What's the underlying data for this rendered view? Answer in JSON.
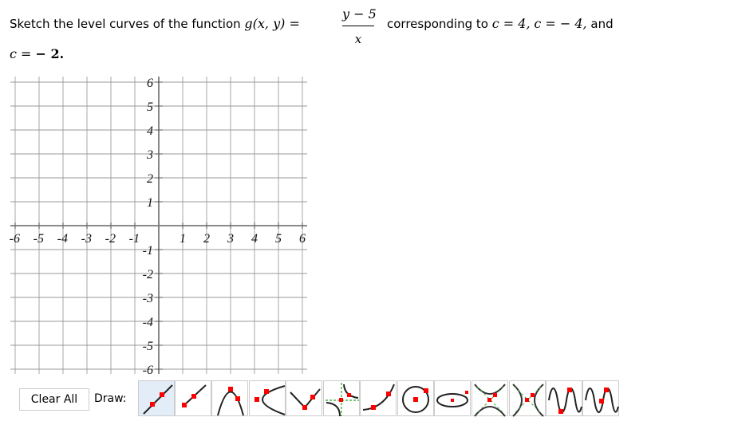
{
  "problem": {
    "text_before": "Sketch the level curves of the function ",
    "function_lhs": "g(x, y) = ",
    "fraction_numerator": "y − 5",
    "fraction_denominator": "x",
    "text_after": "corresponding to ",
    "c1": "c = 4,",
    "c2": "c =  − 4,",
    "text_and": " and",
    "c3_label": "c = ",
    "c3_value": " − 2."
  },
  "graph": {
    "x_range": [
      -6,
      6
    ],
    "y_range": [
      -6,
      6
    ],
    "x_tick_labels": [
      "-6",
      "-5",
      "-4",
      "-3",
      "-2",
      "-1",
      "1",
      "2",
      "3",
      "4",
      "5",
      "6"
    ],
    "y_tick_labels_positive": [
      "1",
      "2",
      "3",
      "4",
      "5",
      "6"
    ],
    "y_tick_labels_negative": [
      "-1",
      "-2",
      "-3",
      "-4",
      "-5",
      "-6"
    ],
    "grid": true
  },
  "toolbar": {
    "clear_label": "Clear All",
    "draw_label": "Draw:",
    "tools": [
      {
        "name": "line-tool",
        "active": true
      },
      {
        "name": "ray-tool",
        "active": false
      },
      {
        "name": "parabola-vertical-tool",
        "active": false
      },
      {
        "name": "parabola-horizontal-tool",
        "active": false
      },
      {
        "name": "absolute-value-tool",
        "active": false
      },
      {
        "name": "rational-tool",
        "active": false
      },
      {
        "name": "exponential-tool",
        "active": false
      },
      {
        "name": "circle-tool",
        "active": false
      },
      {
        "name": "ellipse-tool",
        "active": false
      },
      {
        "name": "hyperbola-vertical-tool",
        "active": false
      },
      {
        "name": "hyperbola-horizontal-tool",
        "active": false
      },
      {
        "name": "sine-tool",
        "active": false
      },
      {
        "name": "cosine-tool",
        "active": false
      }
    ]
  }
}
